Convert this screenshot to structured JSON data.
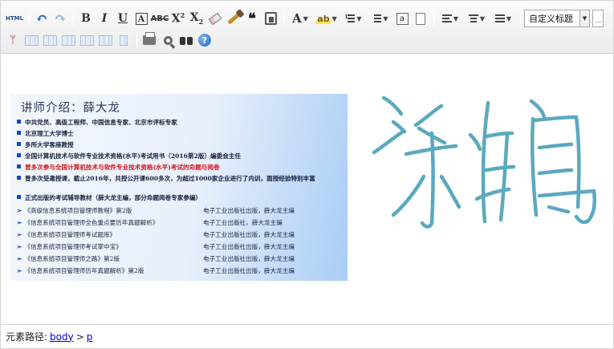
{
  "toolbar": {
    "row1": {
      "source_label": "HTML",
      "bold": "B",
      "italic": "I",
      "underline": "U",
      "font_border": "A",
      "strikethrough": "ABC",
      "superscript": "X",
      "superscript_mark": "2",
      "subscript": "X",
      "subscript_mark": "2",
      "blockquote": "❝",
      "fontcolor": "A",
      "backcolor": "ab",
      "insert_code": "a",
      "dropdown_mark": "▼",
      "custom_title_value": "自定义标题",
      "font_size_trunc": "..."
    },
    "row2": {
      "help": "?"
    }
  },
  "content": {
    "banner": {
      "title": "讲师介绍：薛大龙",
      "bullets": [
        "中共党员、高级工程师、中国信息专家、北京市评标专家",
        "北京理工大学博士",
        "多所大学客座教授",
        "全国计算机技术与软件专业技术资格(水平)考试用书（2016第2版）编委会主任"
      ],
      "red_bullet": "曾多次参与全国计算机技术与软件专业技术资格(水平)考试的命题与阅卷",
      "multi_bullet": "曾多次受邀授课，截止2016年，共授公开课600多次，为超过1000家企业进行了内训，面授经验特别丰富",
      "textbook_bullet": "正式出版的考试辅导教材（薛大龙主编，部分命题阅卷专家参编）",
      "books": [
        {
          "title": "《高级信息系统项目管理师教程》第2版",
          "publisher": "电子工业出版社出版，薛大龙主编"
        },
        {
          "title": "《信息系统项目管理师全色重点要历年真题解析》",
          "publisher": "电子工业出版社，薛大龙主编"
        },
        {
          "title": "《信息系统项目管理师考试题库》",
          "publisher": "电子工业出版社出版，薛大龙主编"
        },
        {
          "title": "《信息系统项目管理师考试掌中宝》",
          "publisher": "电子工业出版社出版，薛大龙主编"
        },
        {
          "title": "《信息系统项目管理师之路》第2版",
          "publisher": "电子工业出版社出版，薛大龙主编"
        },
        {
          "title": "《信息系统项目管理师历年真题解析》第2版",
          "publisher": "电子工业出版社出版，薛大龙主编"
        }
      ]
    },
    "scribble_color": "#5aa9bf"
  },
  "statusbar": {
    "label": "元素路径:",
    "path": [
      "body",
      "p"
    ],
    "separator": ">"
  }
}
